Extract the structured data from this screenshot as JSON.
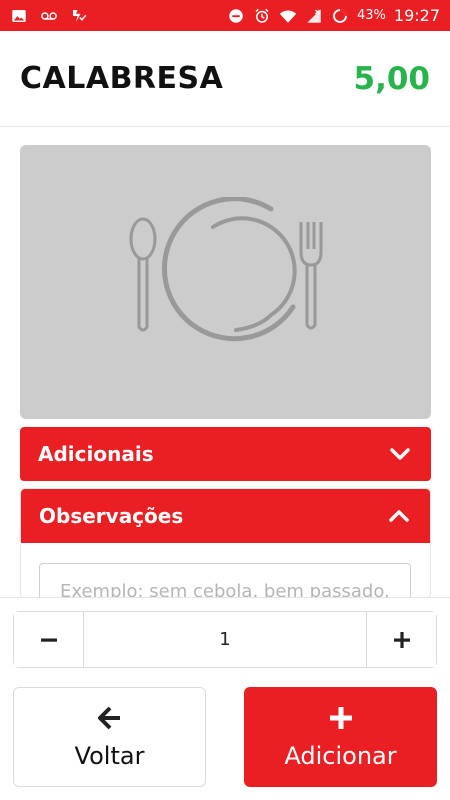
{
  "statusbar": {
    "icons": [
      "image-icon",
      "voicemail-icon",
      "app-check-icon",
      "do-not-disturb-icon",
      "alarm-icon",
      "wifi-icon",
      "signal-icon",
      "battery-saver-icon"
    ],
    "battery": "43%",
    "time": "19:27"
  },
  "product": {
    "title": "CALABRESA",
    "price": "5,00",
    "image_icon": "plate-cutlery-icon"
  },
  "sections": {
    "adicionais": {
      "title": "Adicionais",
      "state_icon": "chevron-down-icon"
    },
    "observacoes": {
      "title": "Observações",
      "state_icon": "chevron-up-icon",
      "input_value": "",
      "input_placeholder": "Exemplo: sem cebola, bem passado..."
    }
  },
  "quantity": {
    "value": "1",
    "minus_icon": "minus-icon",
    "plus_icon": "plus-icon"
  },
  "actions": {
    "back_label": "Voltar",
    "back_icon": "arrow-left-icon",
    "add_label": "Adicionar",
    "add_icon": "plus-icon"
  },
  "colors": {
    "accent": "#ea1f23",
    "price": "#28b44c",
    "placeholder_bg": "#cccccc"
  }
}
